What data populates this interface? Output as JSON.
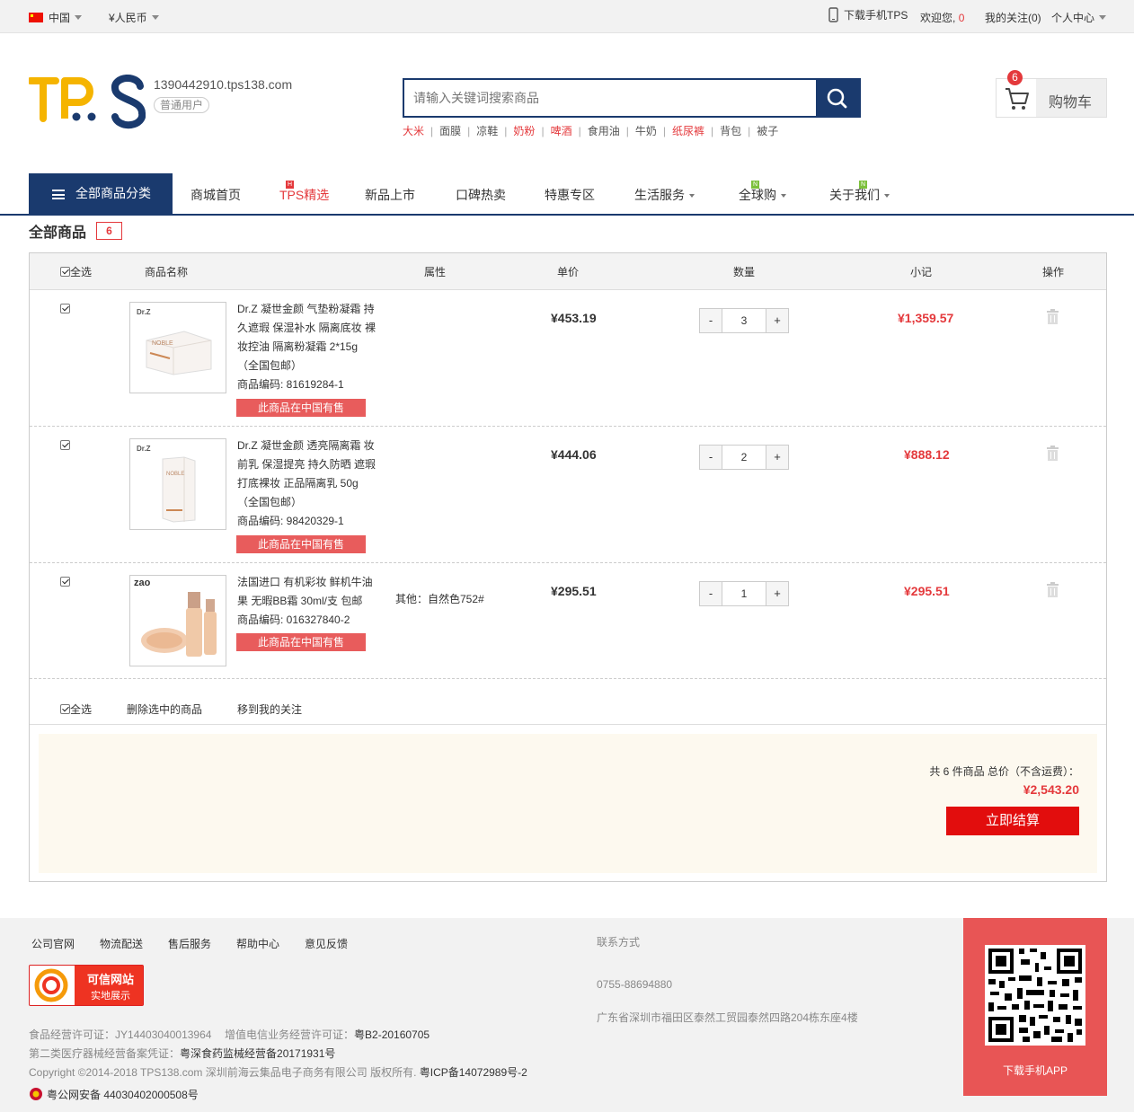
{
  "topbar": {
    "country": "中国",
    "currency": "¥人民币",
    "download": "下载手机TPS",
    "welcome": "欢迎您,",
    "msg_count": "0",
    "follow": "我的关注(0)",
    "user_center": "个人中心"
  },
  "header": {
    "account": "1390442910.tps138.com",
    "user_level": "普通用户",
    "search_placeholder": "请输入关键词搜索商品",
    "hot_words": [
      "大米",
      "面膜",
      "凉鞋",
      "奶粉",
      "啤酒",
      "食用油",
      "牛奶",
      "纸尿裤",
      "背包",
      "被子"
    ],
    "cart_label": "购物车",
    "cart_count": "6"
  },
  "nav": {
    "all_categories": "全部商品分类",
    "items": [
      "商城首页",
      "TPS精选",
      "新品上市",
      "口碑热卖",
      "特惠专区",
      "生活服务",
      "全球购",
      "关于我们"
    ],
    "tags": {
      "hot": "H",
      "new": "N"
    }
  },
  "cart": {
    "title": "全部商品",
    "count": "6",
    "headers": {
      "select_all": "全选",
      "name": "商品名称",
      "attr": "属性",
      "price": "单价",
      "qty": "数量",
      "subtotal": "小记",
      "op": "操作"
    },
    "items": [
      {
        "name": "Dr.Z 凝世金颜 气垫粉凝霜 持久遮瑕 保湿补水 隔离底妆 裸妆控油 隔离粉凝霜 2*15g （全国包邮）",
        "code": "商品编码: 81619284-1",
        "stock": "此商品在中国有售",
        "attr": "",
        "price": "¥453.19",
        "qty": "3",
        "subtotal": "¥1,359.57",
        "img_brand": "Dr.Z",
        "img_text": "NOBLE"
      },
      {
        "name": "Dr.Z 凝世金颜 透亮隔离霜 妆前乳 保湿提亮 持久防晒 遮瑕打底裸妆 正品隔离乳 50g （全国包邮）",
        "code": "商品编码: 98420329-1",
        "stock": "此商品在中国有售",
        "attr": "",
        "price": "¥444.06",
        "qty": "2",
        "subtotal": "¥888.12",
        "img_brand": "Dr.Z",
        "img_text": "NOBLE"
      },
      {
        "name": "法国进口 有机彩妆 鲜机牛油果 无暇BB霜 30ml/支 包邮",
        "code": "商品编码: 016327840-2",
        "stock": "此商品在中国有售",
        "attr": "其他：自然色752#",
        "price": "¥295.51",
        "qty": "1",
        "subtotal": "¥295.51",
        "img_brand": "zao"
      }
    ],
    "footer_actions": {
      "select_all": "全选",
      "delete": "删除选中的商品",
      "move": "移到我的关注"
    },
    "summary": {
      "text": "共 6 件商品 总价（不含运费）：",
      "total": "¥2,543.20",
      "checkout": "立即结算"
    }
  },
  "footer": {
    "links": [
      "公司官网",
      "物流配送",
      "售后服务",
      "帮助中心",
      "意见反馈"
    ],
    "trust_title": "可信网站",
    "trust_sub": "实地展示",
    "license1_label": "食品经营许可证：",
    "license1_val": "JY14403040013964",
    "license2_label": "增值电信业务经营许可证：",
    "license2_val": "粤B2-20160705",
    "license3_label": "第二类医疗器械经营备案凭证：",
    "license3_val": "粤深食药监械经营备20171931号",
    "copyright": "Copyright ©2014-2018 TPS138.com 深圳前海云集品电子商务有限公司 版权所有.",
    "icp": "粤ICP备14072989号-2",
    "police": "粤公网安备 44030402000508号",
    "contact_title": "联系方式",
    "phone": "0755-88694880",
    "address": "广东省深圳市福田区泰然工贸园泰然四路204栋东座4楼",
    "app_label": "下载手机APP"
  }
}
